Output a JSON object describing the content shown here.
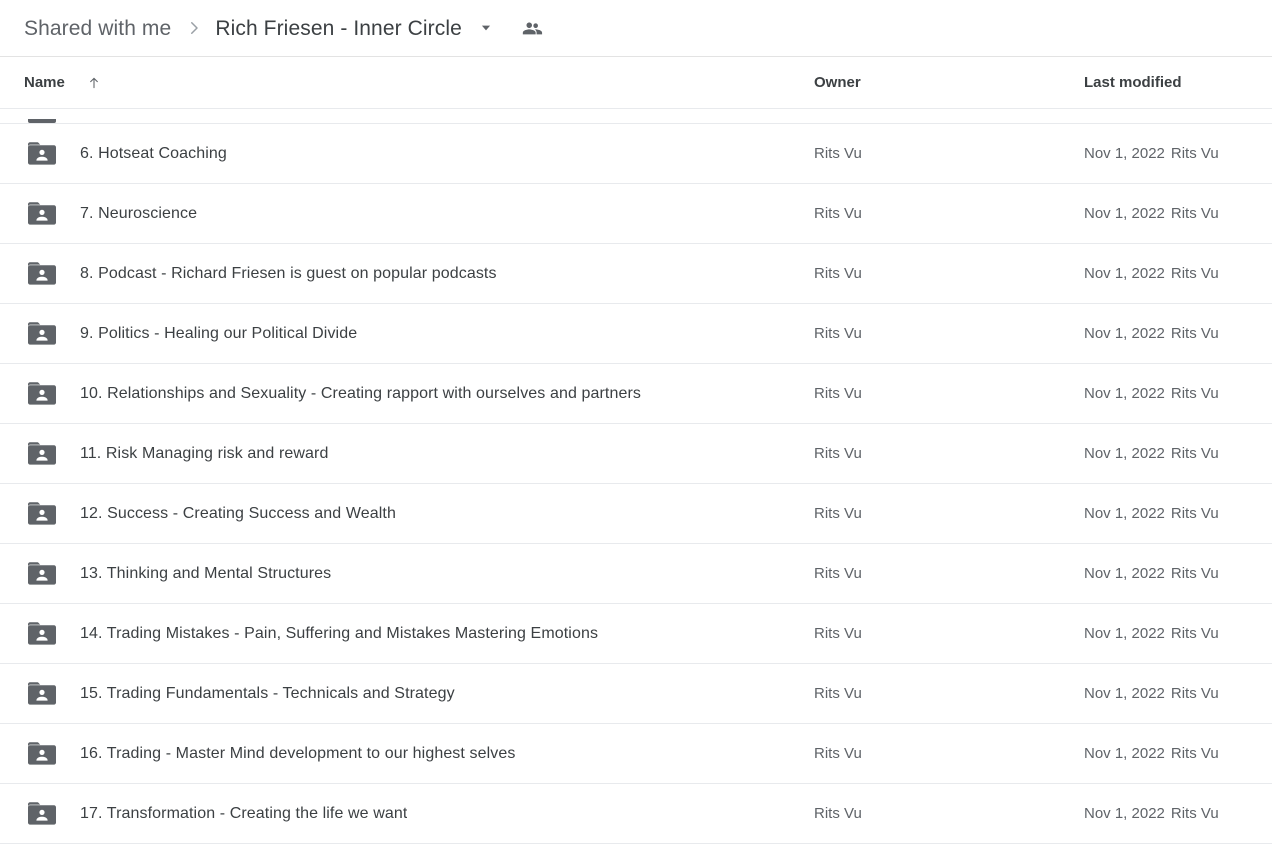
{
  "breadcrumb": {
    "parent_label": "Shared with me",
    "separator_icon": "chevron-right-icon",
    "current_label": "Rich Friesen - Inner Circle",
    "caret_icon": "chevron-down-icon",
    "people_icon": "people-shared-icon"
  },
  "columns": {
    "name": "Name",
    "sort_icon": "arrow-up-icon",
    "owner": "Owner",
    "last_modified": "Last modified"
  },
  "colors": {
    "folder_icon": "#5f6368",
    "primary_text": "#3c4043",
    "secondary_text": "#5f6368",
    "divider": "#e8eaed",
    "row_hover": "#f8f9fa"
  },
  "rows": [
    {
      "icon": "shared-folder-icon",
      "name": "6. Hotseat Coaching",
      "owner": "Rits Vu",
      "modified_date": "Nov 1, 2022",
      "modified_by": "Rits Vu"
    },
    {
      "icon": "shared-folder-icon",
      "name": "7. Neuroscience",
      "owner": "Rits Vu",
      "modified_date": "Nov 1, 2022",
      "modified_by": "Rits Vu"
    },
    {
      "icon": "shared-folder-icon",
      "name": "8. Podcast - Richard Friesen is guest on popular podcasts",
      "owner": "Rits Vu",
      "modified_date": "Nov 1, 2022",
      "modified_by": "Rits Vu"
    },
    {
      "icon": "shared-folder-icon",
      "name": "9. Politics - Healing our Political Divide",
      "owner": "Rits Vu",
      "modified_date": "Nov 1, 2022",
      "modified_by": "Rits Vu"
    },
    {
      "icon": "shared-folder-icon",
      "name": "10. Relationships and Sexuality - Creating rapport with ourselves and partners",
      "owner": "Rits Vu",
      "modified_date": "Nov 1, 2022",
      "modified_by": "Rits Vu"
    },
    {
      "icon": "shared-folder-icon",
      "name": "11. Risk Managing risk and reward",
      "owner": "Rits Vu",
      "modified_date": "Nov 1, 2022",
      "modified_by": "Rits Vu"
    },
    {
      "icon": "shared-folder-icon",
      "name": "12. Success - Creating Success and Wealth",
      "owner": "Rits Vu",
      "modified_date": "Nov 1, 2022",
      "modified_by": "Rits Vu"
    },
    {
      "icon": "shared-folder-icon",
      "name": "13. Thinking and Mental Structures",
      "owner": "Rits Vu",
      "modified_date": "Nov 1, 2022",
      "modified_by": "Rits Vu"
    },
    {
      "icon": "shared-folder-icon",
      "name": "14. Trading Mistakes - Pain, Suffering and Mistakes Mastering Emotions",
      "owner": "Rits Vu",
      "modified_date": "Nov 1, 2022",
      "modified_by": "Rits Vu"
    },
    {
      "icon": "shared-folder-icon",
      "name": "15. Trading Fundamentals - Technicals and Strategy",
      "owner": "Rits Vu",
      "modified_date": "Nov 1, 2022",
      "modified_by": "Rits Vu"
    },
    {
      "icon": "shared-folder-icon",
      "name": "16. Trading - Master Mind development to our highest selves",
      "owner": "Rits Vu",
      "modified_date": "Nov 1, 2022",
      "modified_by": "Rits Vu"
    },
    {
      "icon": "shared-folder-icon",
      "name": "17. Transformation - Creating the life we want",
      "owner": "Rits Vu",
      "modified_date": "Nov 1, 2022",
      "modified_by": "Rits Vu"
    }
  ]
}
